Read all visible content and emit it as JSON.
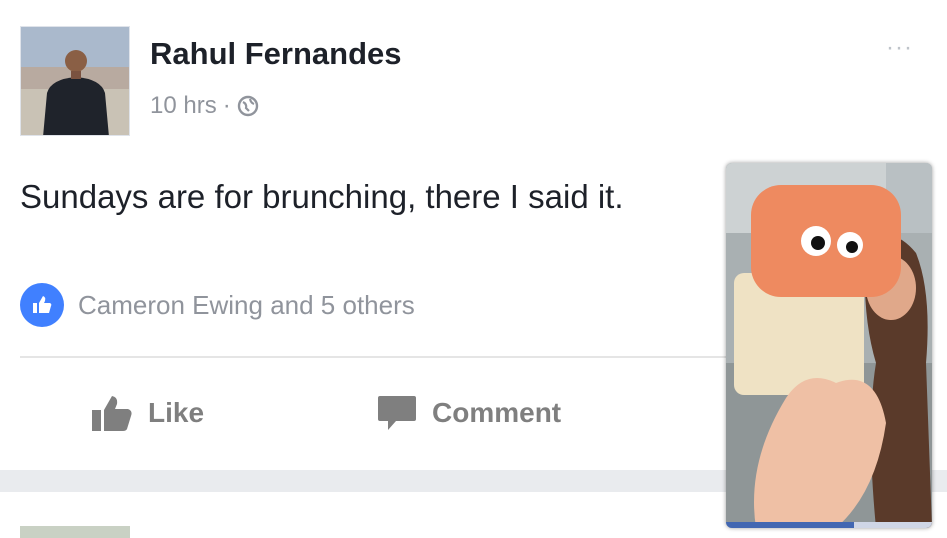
{
  "post": {
    "author": "Rahul Fernandes",
    "timestamp": "10 hrs",
    "separator": "·",
    "privacy_icon": "globe-icon",
    "more_icon": "more-options-icon",
    "more_text": "···",
    "text": "Sundays are for brunching, there I said it.",
    "reactions": {
      "icon": "like-reaction-icon",
      "summary": "Cameron Ewing and 5 others"
    },
    "actions": {
      "like_label": "Like",
      "comment_label": "Comment"
    }
  },
  "video_overlay": {
    "progress": 0.62
  },
  "colors": {
    "text": "#1d2129",
    "secondary": "#90949c",
    "like_blue": "#4080ff",
    "action_gray": "#7f7f7f",
    "feed_bg": "#e9ebee",
    "progress_blue": "#4267b2"
  }
}
